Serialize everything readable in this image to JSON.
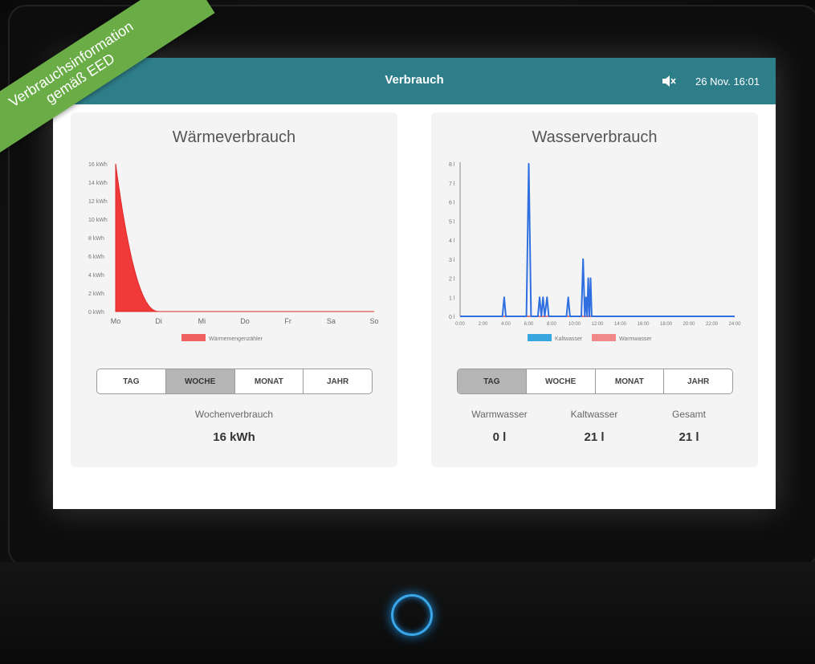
{
  "header": {
    "title": "Verbrauch",
    "datetime": "26 Nov. 16:01"
  },
  "ribbon": {
    "line1": "Verbrauchsinformation",
    "line2": "gemäß EED"
  },
  "heat": {
    "title": "Wärmeverbrauch",
    "tabs": [
      "TAG",
      "WOCHE",
      "MONAT",
      "JAHR"
    ],
    "active_tab": "WOCHE",
    "stat_label": "Wochenverbrauch",
    "stat_value": "16 kWh"
  },
  "water": {
    "title": "Wasserverbrauch",
    "tabs": [
      "TAG",
      "WOCHE",
      "MONAT",
      "JAHR"
    ],
    "active_tab": "TAG",
    "stats": [
      {
        "label": "Warmwasser",
        "value": "0 l"
      },
      {
        "label": "Kaltwasser",
        "value": "21 l"
      },
      {
        "label": "Gesamt",
        "value": "21 l"
      }
    ]
  },
  "chart_data": [
    {
      "type": "area",
      "title": "",
      "categories": [
        "Mo",
        "Di",
        "Mi",
        "Do",
        "Fr",
        "Sa",
        "So"
      ],
      "y_ticks": [
        "0 kWh",
        "2 kWh",
        "4 kWh",
        "6 kWh",
        "8 kWh",
        "10 kWh",
        "12 kWh",
        "14 kWh",
        "16 kWh"
      ],
      "ylim": [
        0,
        16
      ],
      "series": [
        {
          "name": "Wärmemengenzähler",
          "color": "#f03a3a",
          "values": [
            16,
            0,
            0,
            0,
            0,
            0,
            0
          ]
        }
      ],
      "legend": "bottom"
    },
    {
      "type": "line",
      "title": "",
      "x_ticks": [
        "0:00",
        "2:00",
        "4:00",
        "6:00",
        "8:00",
        "10:00",
        "12:00",
        "14:00",
        "16:00",
        "18:00",
        "20:00",
        "22:00",
        "24:00"
      ],
      "y_ticks": [
        "0 l",
        "1 l",
        "2 l",
        "3 l",
        "4 l",
        "5 l",
        "6 l",
        "7 l",
        "8 l"
      ],
      "xlim": [
        0,
        24
      ],
      "ylim": [
        0,
        8
      ],
      "series": [
        {
          "name": "Kaltwasser",
          "color": "#2f6fe0",
          "points": [
            [
              0,
              0
            ],
            [
              3.7,
              0
            ],
            [
              3.85,
              1
            ],
            [
              4.0,
              0
            ],
            [
              5.8,
              0
            ],
            [
              6.0,
              8
            ],
            [
              6.2,
              0
            ],
            [
              6.8,
              0
            ],
            [
              6.95,
              1
            ],
            [
              7.1,
              0
            ],
            [
              7.25,
              1
            ],
            [
              7.4,
              0
            ],
            [
              7.6,
              1
            ],
            [
              7.75,
              0
            ],
            [
              9.3,
              0
            ],
            [
              9.45,
              1
            ],
            [
              9.6,
              0
            ],
            [
              10.6,
              0
            ],
            [
              10.75,
              3
            ],
            [
              10.9,
              0
            ],
            [
              11.0,
              1
            ],
            [
              11.1,
              0
            ],
            [
              11.2,
              2
            ],
            [
              11.3,
              0
            ],
            [
              11.4,
              2
            ],
            [
              11.5,
              0
            ],
            [
              24,
              0
            ]
          ]
        },
        {
          "name": "Warmwasser",
          "color": "#f07a7a",
          "points": [
            [
              0,
              0
            ],
            [
              24,
              0
            ]
          ]
        }
      ],
      "legend": "bottom"
    }
  ]
}
